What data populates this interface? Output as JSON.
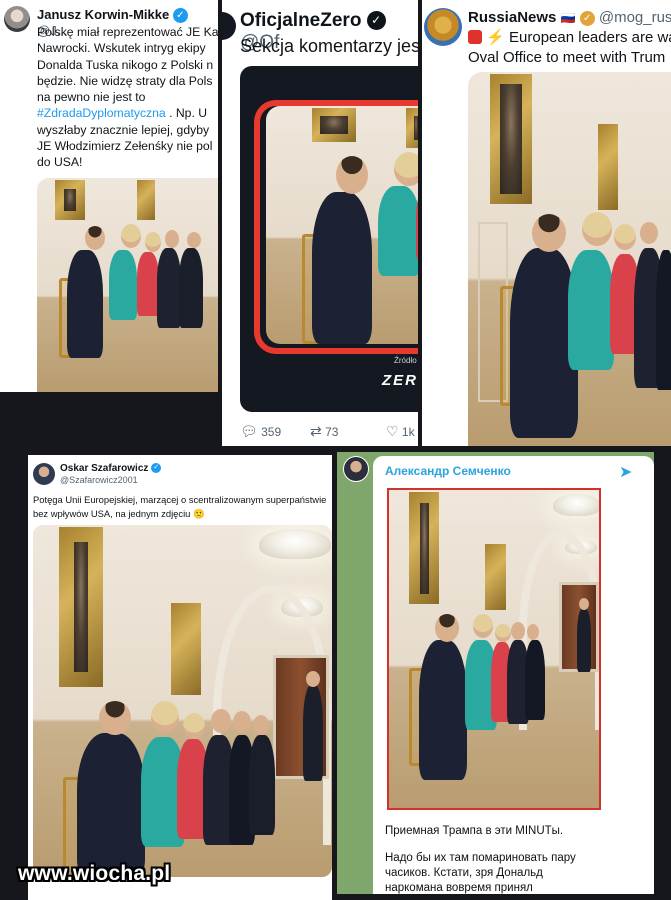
{
  "tweet1": {
    "name": "Janusz Korwin-Mikke",
    "handle": "@J...",
    "text_lines": [
      "Polskę miał reprezentować JE Ka",
      "Nawrocki. Wskutek intryg ekipy",
      "Donalda Tuska nikogo z Polski n",
      "będzie. Nie widzę straty dla Pols",
      "na pewno nie jest to"
    ],
    "hashtag": "#ZdradaDyplomatyczna",
    "text_after_hashtag": ". Np. U",
    "text_lines_2": [
      "wyszłaby znacznie lepiej, gdyby",
      "JE Włodzimierz Zełenśky nie pol",
      "do USA!"
    ]
  },
  "tweet2": {
    "name": "OficjalneZero",
    "handle": "@Of",
    "text": "Sekcja komentarzy jes",
    "source_label": "Źródło",
    "brand": "ZER",
    "stats": {
      "replies": "359",
      "retweets": "73",
      "likes": "1k"
    }
  },
  "tweet3": {
    "name": "RussiaNews",
    "flag": "🇷🇺",
    "handle": "@mog_rus",
    "text_line1": "European leaders are wa",
    "text_line2": "Oval Office to meet with Trum"
  },
  "tweet4": {
    "name": "Oskar Szafarowicz",
    "handle": "@Szafarowicz2001",
    "text_line1": "Potęga Unii Europejskiej, marzącej o scentralizowanym superpaństwie",
    "text_line2": "bez wpływów USA, na jednym zdjęciu",
    "emoji": "🙁"
  },
  "telegram": {
    "channel": "Александр Семченко",
    "caption_line1": "Приемная Трампа в эти MINUTы.",
    "caption_line2": "Надо бы их там помариновать пару",
    "caption_line3": "часиков. Кстати, зря Дональд",
    "caption_line4": "наркомана вовремя принял"
  },
  "watermark": "www.wiocha.pl",
  "colors": {
    "twitter_blue": "#1d9bf0",
    "telegram_blue": "#2aa3df",
    "telegram_bg": "#7fa66b",
    "zero_red": "#e8392f",
    "zero_dark": "#141821"
  }
}
